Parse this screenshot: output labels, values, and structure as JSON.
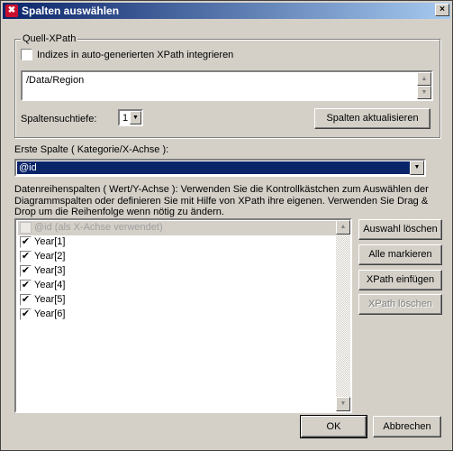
{
  "window": {
    "title": "Spalten auswählen",
    "close_glyph": "×"
  },
  "quell_xpath": {
    "legend": "Quell-XPath",
    "indices_checkbox_label": "Indizes in auto-generierten XPath integrieren",
    "xpath_value": "/Data/Region",
    "depth_label": "Spaltensuchtiefe:",
    "depth_value": "1",
    "refresh_button": "Spalten aktualisieren"
  },
  "first_column": {
    "label": "Erste Spalte ( Kategorie/X-Achse ):",
    "value": "@id"
  },
  "series": {
    "description": "Datenreihenspalten ( Wert/Y-Achse ): Verwenden Sie die Kontrollkästchen zum Auswählen der Diagrammspalten oder definieren Sie mit Hilfe von XPath ihre eigenen. Verwenden Sie Drag & Drop um die Reihenfolge wenn nötig zu ändern.",
    "items": [
      {
        "label": "@id (als X-Achse verwendet)",
        "checked": false,
        "disabled": true
      },
      {
        "label": "Year[1]",
        "checked": true
      },
      {
        "label": "Year[2]",
        "checked": true
      },
      {
        "label": "Year[3]",
        "checked": true
      },
      {
        "label": "Year[4]",
        "checked": true
      },
      {
        "label": "Year[5]",
        "checked": true
      },
      {
        "label": "Year[6]",
        "checked": true
      }
    ]
  },
  "side_buttons": {
    "clear_selection": "Auswahl löschen",
    "mark_all": "Alle markieren",
    "insert_xpath": "XPath einfügen",
    "delete_xpath": "XPath löschen"
  },
  "footer": {
    "ok": "OK",
    "cancel": "Abbrechen"
  },
  "glyphs": {
    "check": "✔",
    "arrow_up": "▲",
    "arrow_down": "▼"
  }
}
